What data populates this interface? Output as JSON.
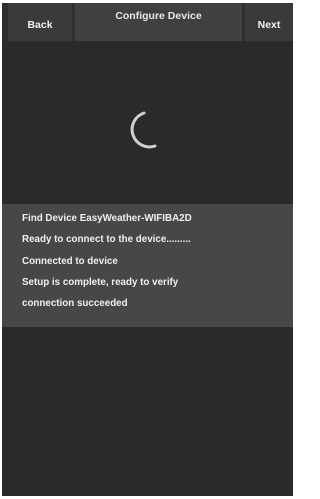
{
  "header": {
    "back_label": "Back",
    "title": "Configure Device",
    "next_label": "Next"
  },
  "spinner": {
    "icon": "loading-spinner-icon",
    "color": "#d0d0d0"
  },
  "status": {
    "lines": [
      "Find Device EasyWeather-WIFIBA2D",
      "Ready to connect to the device.........",
      "Connected to device",
      "Setup is complete, ready to verify",
      "connection succeeded"
    ]
  }
}
